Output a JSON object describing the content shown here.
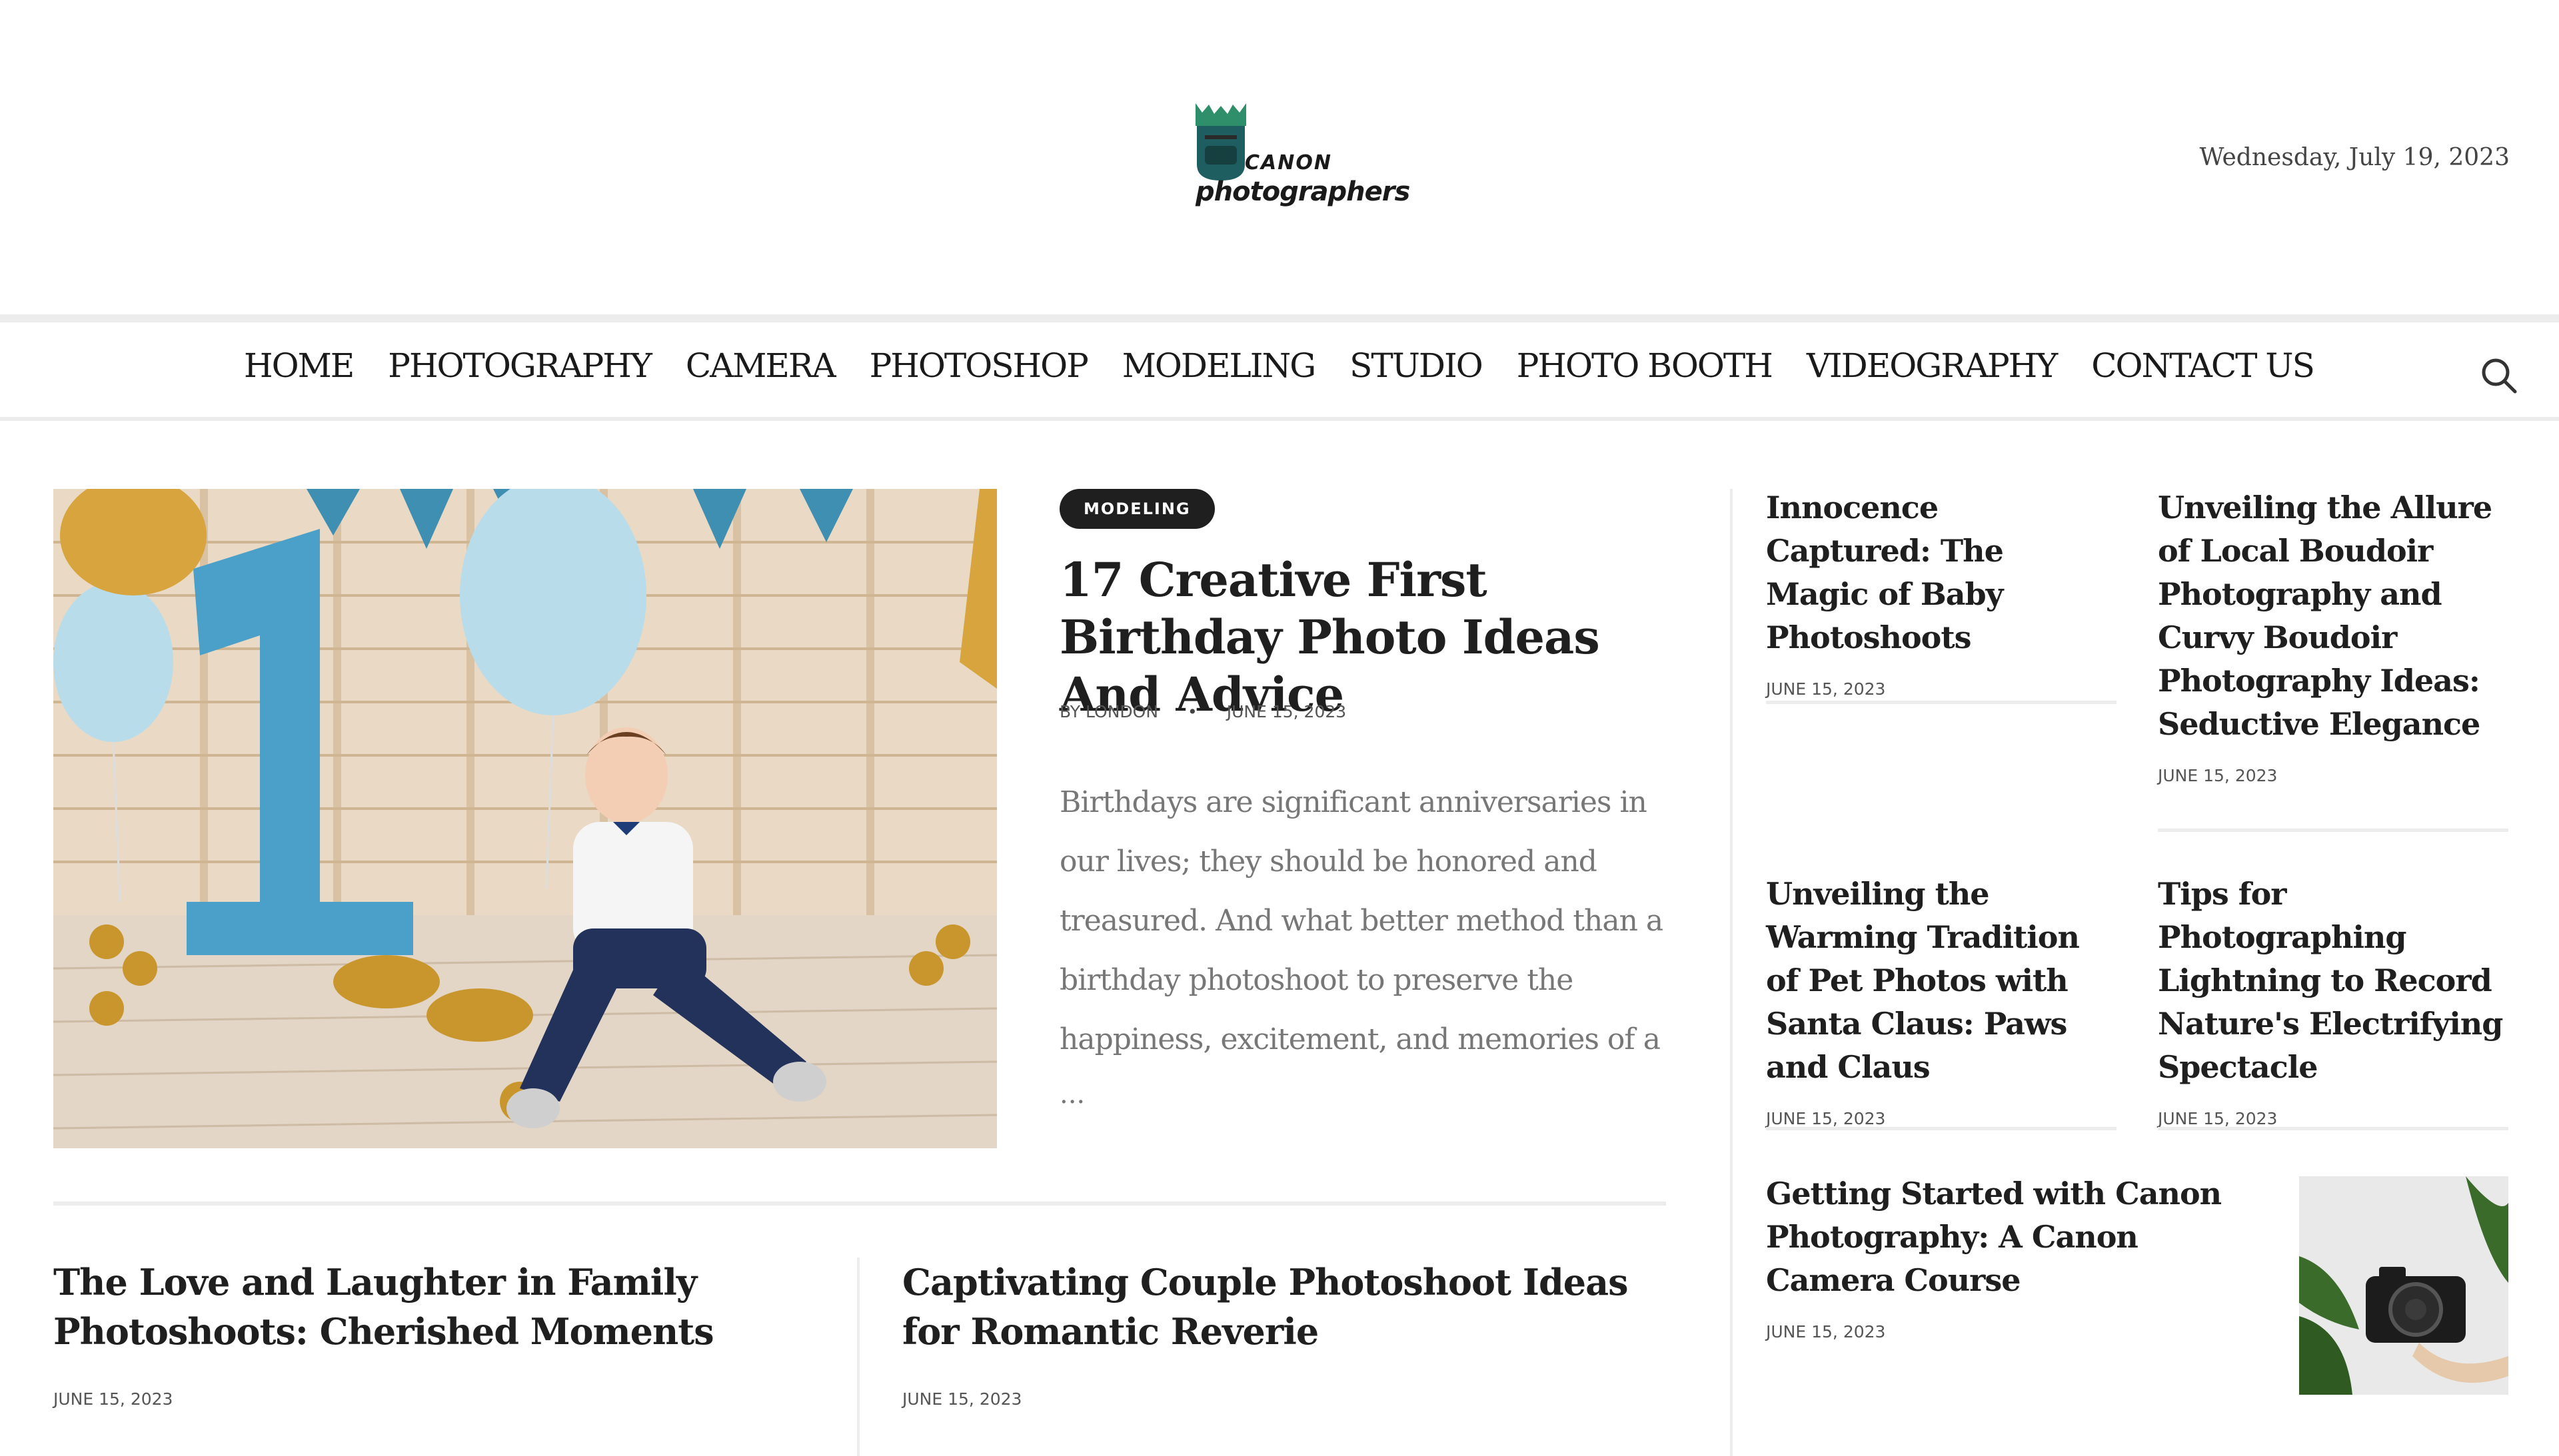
{
  "header": {
    "logo_small": "CANON",
    "logo_big": "photographers",
    "date": "Wednesday, July 19, 2023"
  },
  "nav": {
    "items": [
      "HOME",
      "PHOTOGRAPHY",
      "CAMERA",
      "PHOTOSHOP",
      "MODELING",
      "STUDIO",
      "PHOTO BOOTH",
      "VIDEOGRAPHY",
      "CONTACT US"
    ]
  },
  "featured": {
    "category": "MODELING",
    "title": "17 Creative First Birthday Photo Ideas And Advice",
    "author_prefix": "BY",
    "author": "LONDON",
    "date": "JUNE 15, 2023",
    "excerpt": "Birthdays are significant anniversaries in our lives; they should be honored and treasured. And what better method than a birthday photoshoot to preserve the happiness, excitement, and memories of a",
    "more": "..."
  },
  "bottom_posts": [
    {
      "title": "The Love and Laughter in Family Photoshoots: Cherished Moments",
      "date": "JUNE 15, 2023"
    },
    {
      "title": "Captivating Couple Photoshoot Ideas for Romantic Reverie",
      "date": "JUNE 15, 2023"
    }
  ],
  "right_posts": [
    {
      "title": "Innocence Captured: The Magic of Baby Photoshoots",
      "date": "JUNE 15, 2023"
    },
    {
      "title": "Unveiling the Allure of Local Boudoir Photography and Curvy Boudoir Photography Ideas: Seductive Elegance",
      "date": "JUNE 15, 2023"
    },
    {
      "title": "Unveiling the Warming Tradition of Pet Photos with Santa Claus: Paws and Claus",
      "date": "JUNE 15, 2023"
    },
    {
      "title": "Tips for Photographing Lightning to Record Nature's Electrifying Spectacle",
      "date": "JUNE 15, 2023"
    },
    {
      "title": "Getting Started with Canon Photography: A Canon Camera Course",
      "date": "JUNE 15, 2023"
    }
  ],
  "colors": {
    "accent_dark": "#1f1f1f",
    "logo_teal": "#1e5e60",
    "logo_green": "#2f8f6a",
    "divider": "#ececec"
  }
}
